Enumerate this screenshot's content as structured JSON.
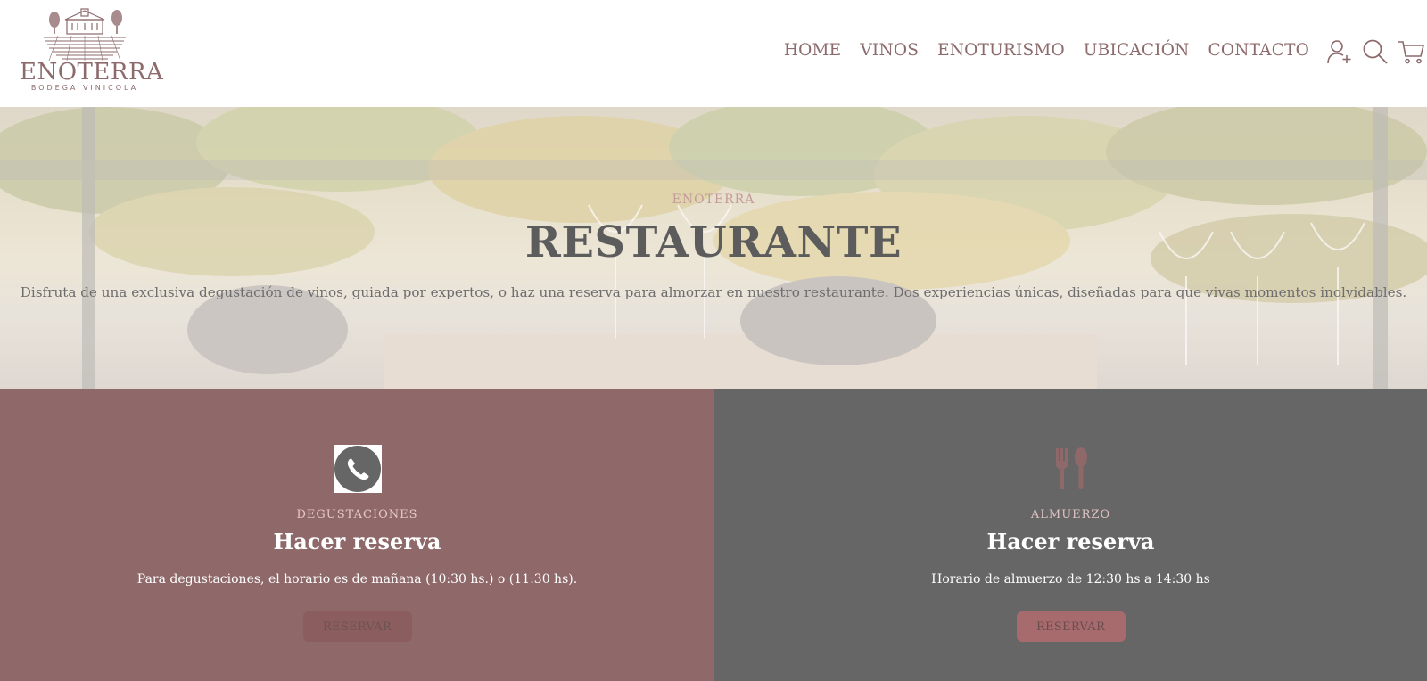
{
  "header": {
    "logo": {
      "name": "ENOTERRA",
      "subtitle": "BODEGA VINICOLA"
    },
    "nav": [
      {
        "label": "HOME"
      },
      {
        "label": "VINOS"
      },
      {
        "label": "ENOTURISMO"
      },
      {
        "label": "UBICACIÓN"
      },
      {
        "label": "CONTACTO"
      }
    ],
    "icons": [
      "user-add-icon",
      "search-icon",
      "cart-icon"
    ]
  },
  "hero": {
    "eyebrow": "ENOTERRA",
    "title": "RESTAURANTE",
    "description": "Disfruta de una exclusiva degustación de vinos, guiada por expertos, o haz una reserva para almorzar en nuestro restaurante. Dos experiencias únicas, diseñadas para que vivas momentos inolvidables."
  },
  "panels": [
    {
      "icon": "phone-icon",
      "eyebrow": "DEGUSTACIONES",
      "title": "Hacer reserva",
      "text": "Para degustaciones, el horario es de mañana (10:30 hs.) o (11:30 hs).",
      "button": "RESERVAR"
    },
    {
      "icon": "fork-spoon-icon",
      "eyebrow": "ALMUERZO",
      "title": "Hacer reserva",
      "text": "Horario de almuerzo de 12:30 hs a 14:30 hs",
      "button": "RESERVAR"
    }
  ],
  "colors": {
    "brand": "#8d6a6b",
    "panel_left": "#8f6869",
    "panel_right": "#666666",
    "button_left": "#8b5d5e",
    "button_right": "#a86b6d"
  }
}
